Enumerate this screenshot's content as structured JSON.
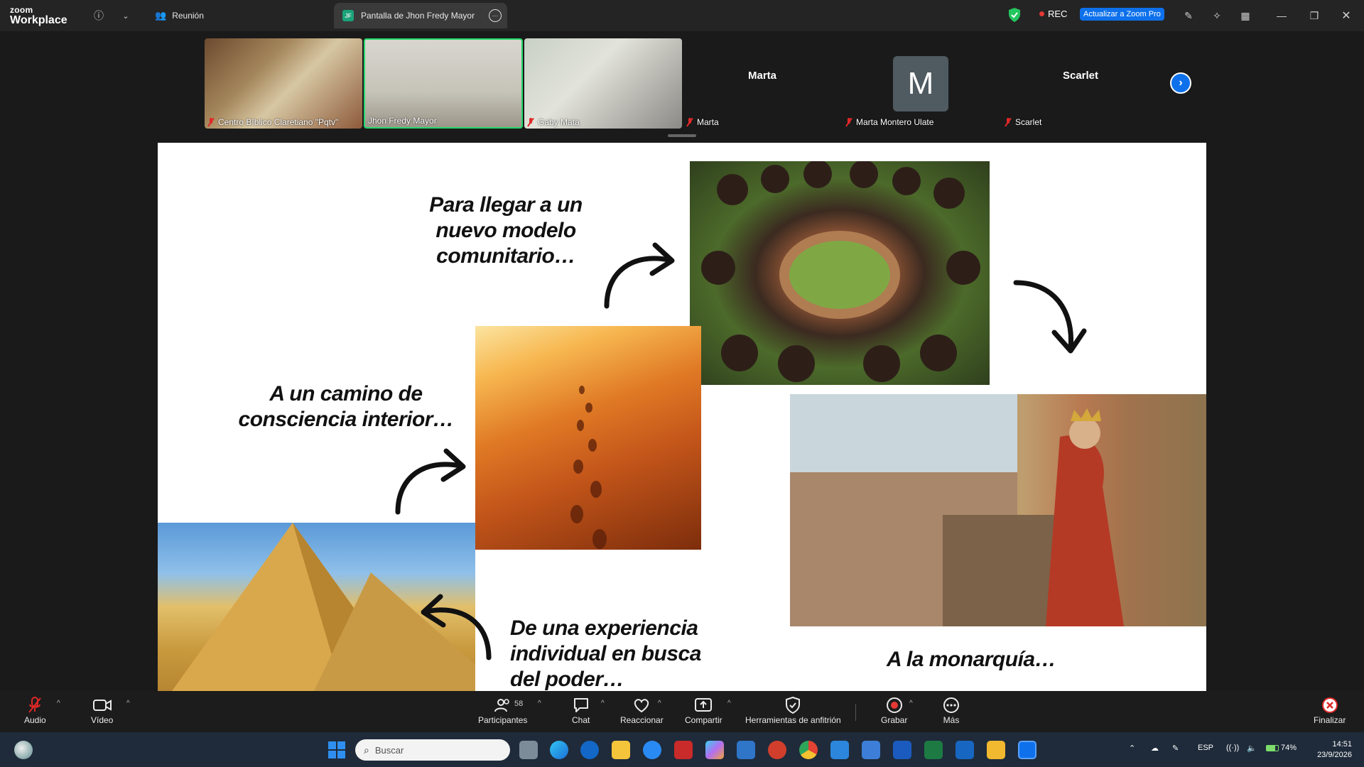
{
  "titlebar": {
    "logo_top": "zoom",
    "logo_bottom": "Workplace",
    "meeting_tab": "Reunión",
    "share_tab": "Pantalla de Jhon Fredy Mayor",
    "share_badge": "JF",
    "rec_label": "REC",
    "upgrade_label": "Actualizar a Zoom Pro"
  },
  "participants_strip": {
    "tiles": [
      {
        "name": "Centro Bíblico Claretiano \"Pqtv\""
      },
      {
        "name": "Jhon Fredy Mayor"
      },
      {
        "name": "Gaby Mata"
      },
      {
        "name": "Marta",
        "display": "Marta"
      },
      {
        "name": "Marta Montero Ulate",
        "avatar_letter": "M"
      },
      {
        "name": "Scarlet",
        "display": "Scarlet"
      }
    ]
  },
  "slide": {
    "text1": "Para llegar a un nuevo modelo comunitario…",
    "text2": "A un camino de consciencia interior…",
    "text3": "De una experiencia individual en busca del poder…",
    "text4": "A la monarquía…"
  },
  "controls": {
    "audio": "Audio",
    "video": "Vídeo",
    "participants": "Participantes",
    "participants_count": "58",
    "chat": "Chat",
    "react": "Reaccionar",
    "share": "Compartir",
    "host_tools": "Herramientas de anfitrión",
    "record": "Grabar",
    "more": "Más",
    "end": "Finalizar"
  },
  "taskbar": {
    "search_placeholder": "Buscar",
    "lang": "ESP",
    "battery": "74%",
    "time": "14:51",
    "date": "23/9/2026"
  },
  "colors": {
    "accent": "#0e71eb",
    "active_speaker": "#23d96b",
    "muted": "#e02828"
  }
}
